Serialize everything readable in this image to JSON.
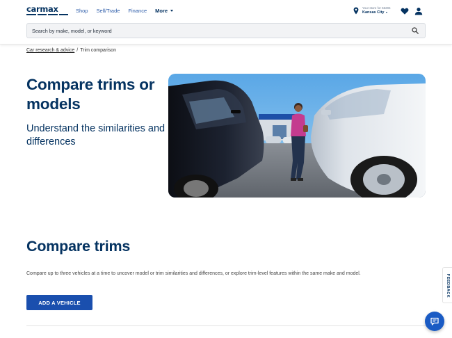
{
  "header": {
    "logo": "carmax",
    "nav": {
      "shop": "Shop",
      "sell_trade": "Sell/Trade",
      "finance": "Finance",
      "more": "More"
    },
    "store": {
      "label": "Your store for 66204",
      "city": "Kansas City"
    },
    "search": {
      "placeholder": "Search by make, model, or keyword",
      "value": ""
    }
  },
  "breadcrumb": {
    "parent": "Car research & advice",
    "separator": "/",
    "current": "Trim comparison"
  },
  "hero": {
    "title": "Compare trims or models",
    "subtitle": "Understand the similarities and differences"
  },
  "compare": {
    "title": "Compare trims",
    "description": "Compare up to three vehicles at a time to uncover model or trim similarities and differences, or explore trim-level features within the same make and model.",
    "button": "ADD A VEHICLE"
  },
  "feedback": "FEEDBACK",
  "icons": {
    "pin": "location-pin-icon",
    "heart": "heart-icon",
    "user": "user-icon",
    "search": "search-icon",
    "chat": "chat-icon"
  },
  "colors": {
    "brand_navy": "#053361",
    "link_blue": "#2a5aa8",
    "button_blue": "#1a4fae",
    "chat_blue": "#1a5bc4"
  }
}
